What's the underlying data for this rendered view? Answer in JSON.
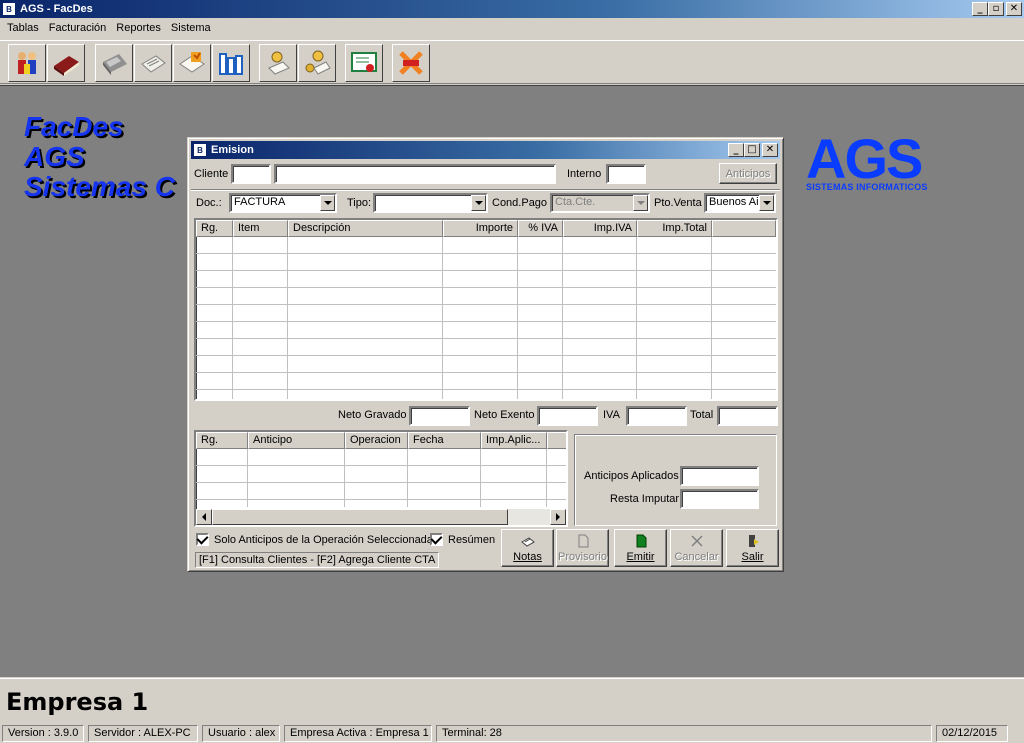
{
  "app": {
    "title": "AGS - FacDes",
    "icon_text": "B"
  },
  "menu": [
    "Tablas",
    "Facturación",
    "Reportes",
    "Sistema"
  ],
  "toolbar": [
    {
      "icon": "people-icon"
    },
    {
      "icon": "book-icon"
    },
    {
      "icon": "calculator-icon"
    },
    {
      "icon": "notepad-icon"
    },
    {
      "icon": "envelope-icon"
    },
    {
      "icon": "bar-chart-icon"
    },
    {
      "icon": "user-document-icon"
    },
    {
      "icon": "users-document-icon"
    },
    {
      "icon": "certificate-icon"
    },
    {
      "icon": "exit-icon"
    }
  ],
  "brand": {
    "lines": [
      "FacDes",
      "AGS",
      "Sistemas C"
    ],
    "logo": "AGS",
    "logo_sub": "SISTEMAS INFORMATICOS"
  },
  "dialog": {
    "title": "Emision",
    "cliente_label": "Cliente",
    "cliente_code": "",
    "cliente_name": "",
    "interno_label": "Interno",
    "interno_value": "",
    "anticipos_button": "Anticipos",
    "doc_label": "Doc.:",
    "doc_value": "FACTURA",
    "tipo_label": "Tipo:",
    "tipo_value": "",
    "cond_pago_label": "Cond.Pago",
    "cond_pago_value": "Cta.Cte.",
    "pto_venta_label": "Pto.Venta",
    "pto_venta_value": "Buenos Air",
    "items_columns": [
      "Rg.",
      "Item",
      "Descripción",
      "Importe",
      "% IVA",
      "Imp.IVA",
      "Imp.Total"
    ],
    "neto_gravado_label": "Neto Gravado",
    "neto_exento_label": "Neto Exento",
    "iva_label": "IVA",
    "total_label": "Total",
    "anticipos_columns": [
      "Rg.",
      "Anticipo",
      "Operacion",
      "Fecha",
      "Imp.Aplic..."
    ],
    "anticipos_aplicados_label": "Anticipos Aplicados",
    "resta_imputar_label": "Resta Imputar",
    "solo_anticipos_label": "Solo Anticipos de la Operación Seleccionada",
    "resumen_label": "Resúmen",
    "hint": "[F1] Consulta Clientes - [F2] Agrega Cliente CTA",
    "buttons": {
      "notas": "Notas",
      "provisorio": "Provisorio",
      "emitir": "Emitir",
      "cancelar": "Cancelar",
      "salir": "Salir"
    }
  },
  "company": "Empresa 1",
  "status": {
    "version": "Version : 3.9.0",
    "servidor": "Servidor : ALEX-PC",
    "usuario": "Usuario : alex",
    "empresa": "Empresa Activa : Empresa 1",
    "terminal": "Terminal: 28",
    "date": "02/12/2015"
  }
}
